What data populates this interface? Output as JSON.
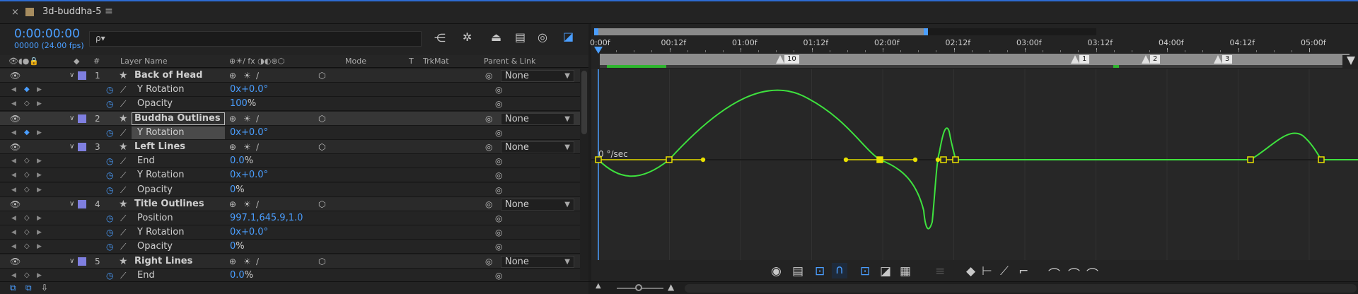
{
  "tab": {
    "title": "3d-buddha-5"
  },
  "timecode": {
    "main": "0:00:00:00",
    "frames": "00000 (24.00 fps)"
  },
  "search": {
    "placeholder": "ρ▾"
  },
  "columns": {
    "layer_name": "Layer Name",
    "num": "#",
    "mode": "Mode",
    "t": "T",
    "trkmat": "TrkMat",
    "parent": "Parent & Link"
  },
  "rows": [
    {
      "kind": "layer",
      "num": "1",
      "name": "Back of Head",
      "parent": "None"
    },
    {
      "kind": "prop",
      "name": "Y Rotation",
      "value_blue": "0x+0.0°",
      "value_white": ""
    },
    {
      "kind": "prop",
      "name": "Opacity",
      "value_blue": "100",
      "value_white": "%"
    },
    {
      "kind": "layer",
      "num": "2",
      "name": "Buddha Outlines",
      "parent": "None"
    },
    {
      "kind": "prop",
      "name": "Y Rotation",
      "value_blue": "0x+0.0°",
      "value_white": ""
    },
    {
      "kind": "layer",
      "num": "3",
      "name": "Left Lines",
      "parent": "None"
    },
    {
      "kind": "prop",
      "name": "End",
      "value_blue": "0.0",
      "value_white": "%"
    },
    {
      "kind": "prop",
      "name": "Y Rotation",
      "value_blue": "0x+0.0°",
      "value_white": ""
    },
    {
      "kind": "prop",
      "name": "Opacity",
      "value_blue": "0",
      "value_white": "%"
    },
    {
      "kind": "layer",
      "num": "4",
      "name": "Title Outlines",
      "parent": "None"
    },
    {
      "kind": "prop",
      "name": "Position",
      "value_blue": "997.1,645.9,1.0",
      "value_white": ""
    },
    {
      "kind": "prop",
      "name": "Y Rotation",
      "value_blue": "0x+0.0°",
      "value_white": ""
    },
    {
      "kind": "prop",
      "name": "Opacity",
      "value_blue": "0",
      "value_white": "%"
    },
    {
      "kind": "layer",
      "num": "5",
      "name": "Right Lines",
      "parent": "None"
    },
    {
      "kind": "prop",
      "name": "End",
      "value_blue": "0.0",
      "value_white": "%"
    }
  ],
  "ruler": {
    "labels": [
      "0:00f",
      "00:12f",
      "01:00f",
      "01:12f",
      "02:00f",
      "02:12f",
      "03:00f",
      "03:12f",
      "04:00f",
      "04:12f",
      "05:00f"
    ]
  },
  "markers": {
    "labels": [
      "10",
      "1",
      "2",
      "3"
    ]
  },
  "graph": {
    "unit_label": "0 °/sec"
  },
  "colors": {
    "accent": "#4a9eff",
    "curve": "#3ee23e",
    "handle": "#e8e000",
    "layer_swatch": "#7f7fe0"
  }
}
